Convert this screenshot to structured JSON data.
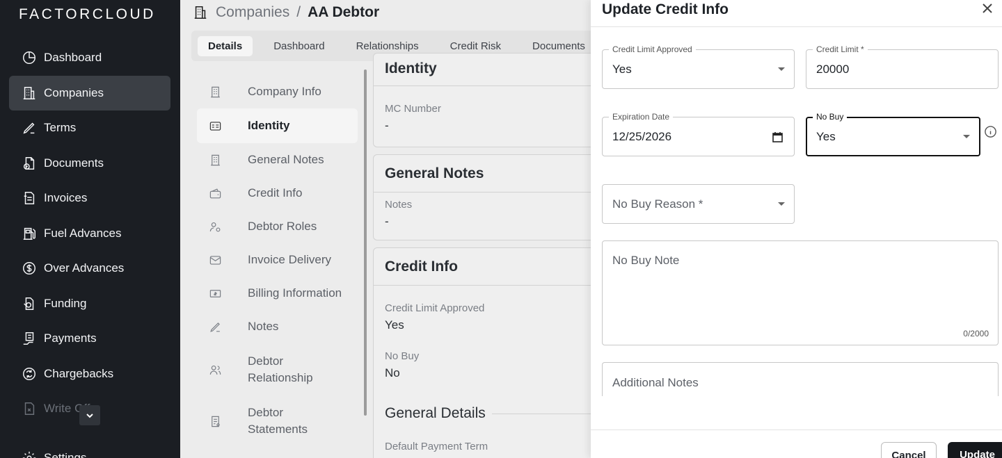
{
  "app": {
    "logo": "FACTORCLOUD"
  },
  "sidebar": {
    "items": [
      {
        "label": "Dashboard",
        "icon": "dashboard-icon"
      },
      {
        "label": "Companies",
        "icon": "building-icon",
        "active": true
      },
      {
        "label": "Terms",
        "icon": "pen-icon"
      },
      {
        "label": "Documents",
        "icon": "documents-icon"
      },
      {
        "label": "Invoices",
        "icon": "invoice-icon"
      },
      {
        "label": "Fuel Advances",
        "icon": "fuel-icon"
      },
      {
        "label": "Over Advances",
        "icon": "dollar-circle-icon"
      },
      {
        "label": "Funding",
        "icon": "funding-icon"
      },
      {
        "label": "Payments",
        "icon": "payments-icon"
      },
      {
        "label": "Chargebacks",
        "icon": "chargeback-icon"
      },
      {
        "label": "Write Offs",
        "icon": "write-off-icon"
      },
      {
        "label": "Settings",
        "icon": "gear-icon"
      }
    ]
  },
  "header": {
    "breadcrumb_parent": "Companies",
    "separator": "/",
    "breadcrumb_current": "AA Debtor"
  },
  "tabs": [
    "Details",
    "Dashboard",
    "Relationships",
    "Credit Risk",
    "Documents"
  ],
  "subnav": [
    {
      "label": "Company Info",
      "icon": "building-icon"
    },
    {
      "label": "Identity",
      "icon": "id-card-icon",
      "active": true
    },
    {
      "label": "General Notes",
      "icon": "building-icon"
    },
    {
      "label": "Credit Info",
      "icon": "wallet-icon"
    },
    {
      "label": "Debtor Roles",
      "icon": "user-gear-icon"
    },
    {
      "label": "Invoice Delivery",
      "icon": "mail-icon"
    },
    {
      "label": "Billing Information",
      "icon": "billing-icon"
    },
    {
      "label": "Notes",
      "icon": "pen-icon"
    },
    {
      "label": "Debtor Relationship",
      "icon": "users-icon"
    },
    {
      "label": "Debtor Statements",
      "icon": "statement-icon"
    }
  ],
  "content": {
    "identity_title": "Identity",
    "mc_label": "MC Number",
    "mc_value": "-",
    "general_notes_title": "General Notes",
    "notes_label": "Notes",
    "notes_value": "-",
    "credit_info_title": "Credit Info",
    "credit_limit_approved_label": "Credit Limit Approved",
    "credit_limit_approved_value": "Yes",
    "no_buy_label": "No Buy",
    "no_buy_value": "No",
    "general_details_title": "General Details",
    "default_payment_term_label": "Default Payment Term"
  },
  "modal": {
    "title": "Update Credit Info",
    "credit_limit_approved": {
      "label": "Credit Limit Approved",
      "value": "Yes"
    },
    "credit_limit": {
      "label": "Credit Limit *",
      "value": "20000"
    },
    "expiration_date": {
      "label": "Expiration Date",
      "value": "12/25/2026"
    },
    "no_buy": {
      "label": "No Buy",
      "value": "Yes"
    },
    "no_buy_reason": {
      "placeholder": "No Buy Reason *"
    },
    "no_buy_note": {
      "placeholder": "No Buy Note",
      "counter": "0/2000"
    },
    "additional_notes": {
      "placeholder": "Additional Notes"
    },
    "cancel_label": "Cancel",
    "update_label": "Update"
  }
}
